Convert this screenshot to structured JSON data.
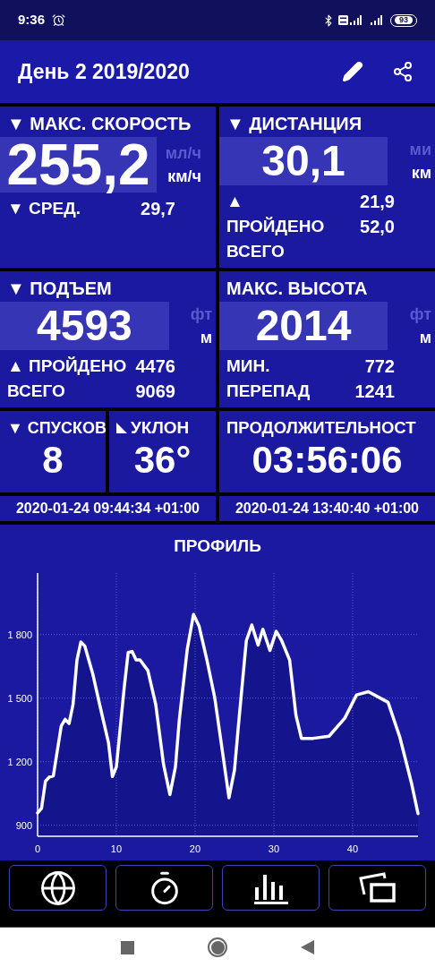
{
  "status_bar": {
    "time": "9:36",
    "battery": "93"
  },
  "app_bar": {
    "title": "День 2 2019/2020"
  },
  "max_speed": {
    "label": "▼ МАКС. СКОРОСТЬ",
    "value": "255,2",
    "units": [
      {
        "label": "мл/ч",
        "selected": false
      },
      {
        "label": "км/ч",
        "selected": true
      }
    ],
    "rows": [
      {
        "label": "▼ СРЕД.",
        "value": "29,7"
      }
    ]
  },
  "distance": {
    "label": "▼ ДИСТАНЦИЯ",
    "value": "30,1",
    "units": [
      {
        "label": "ми",
        "selected": false
      },
      {
        "label": "км",
        "selected": true
      }
    ],
    "rows": [
      {
        "label": "▲",
        "value": "21,9"
      },
      {
        "label": "ПРОЙДЕНО",
        "value": "52,0"
      },
      {
        "label": "ВСЕГО"
      }
    ]
  },
  "ascent": {
    "label": "▼ ПОДЪЕМ",
    "value": "4593",
    "units": [
      {
        "label": "фт",
        "selected": false
      },
      {
        "label": "м",
        "selected": true
      }
    ],
    "rows": [
      {
        "label": "▲ ПРОЙДЕНО",
        "value": "4476"
      },
      {
        "label": "ВСЕГО",
        "value": "9069"
      }
    ]
  },
  "max_altitude": {
    "label": "МАКС. ВЫСОТА",
    "value": "2014",
    "units": [
      {
        "label": "фт",
        "selected": false
      },
      {
        "label": "м",
        "selected": true
      }
    ],
    "rows": [
      {
        "label": "МИН.",
        "value": "772"
      },
      {
        "label": "ПЕРЕПАД",
        "value": "1241"
      }
    ]
  },
  "descents": {
    "label": "▼ СПУСКОВ",
    "value": "8"
  },
  "slope": {
    "label": "УКЛОН",
    "value": "36°"
  },
  "duration": {
    "label": "ПРОДОЛЖИТЕЛЬНОСТ",
    "value": "03:56:06"
  },
  "start_time": "2020-01-24 09:44:34 +01:00",
  "end_time": "2020-01-24 13:40:40 +01:00",
  "profile": {
    "title": "ПРОФИЛЬ",
    "chart_data": {
      "type": "area",
      "grid": true,
      "x": [
        0,
        0.5,
        1,
        1.5,
        2,
        3,
        3.5,
        4,
        4.5,
        5,
        5.5,
        6,
        7,
        8,
        9,
        9.5,
        10,
        11,
        11.5,
        12,
        12.5,
        13,
        14,
        15,
        16,
        16.8,
        17.5,
        18,
        19,
        19.8,
        20.5,
        21.5,
        22.5,
        23.5,
        24.3,
        25,
        25.5,
        26.5,
        27.2,
        28,
        28.6,
        29.5,
        30.3,
        31,
        32,
        32.8,
        33.5,
        35,
        37,
        39,
        40.5,
        42,
        43.5,
        44.5,
        46,
        47.5,
        48.3
      ],
      "series": [
        {
          "color": "#ffffff",
          "values": [
            958,
            980,
            1108,
            1128,
            1133,
            1368,
            1400,
            1380,
            1470,
            1680,
            1765,
            1745,
            1615,
            1450,
            1290,
            1130,
            1175,
            1550,
            1715,
            1720,
            1680,
            1680,
            1630,
            1470,
            1185,
            1045,
            1175,
            1400,
            1730,
            1895,
            1840,
            1680,
            1500,
            1240,
            1030,
            1160,
            1370,
            1770,
            1845,
            1750,
            1825,
            1725,
            1815,
            1770,
            1680,
            1420,
            1310,
            1310,
            1320,
            1405,
            1515,
            1530,
            1500,
            1480,
            1315,
            1095,
            955
          ]
        }
      ],
      "xlim": [
        0,
        48.3
      ],
      "ylim": [
        848,
        2090
      ],
      "xticks": [
        0,
        10,
        20,
        30,
        40
      ],
      "yticks": [
        {
          "value": 900,
          "label": "900"
        },
        {
          "value": 1200,
          "label": "1 200"
        },
        {
          "value": 1500,
          "label": "1 500"
        },
        {
          "value": 1800,
          "label": "1 800"
        }
      ]
    }
  },
  "bottom_tabs": [
    {
      "kind": "globe"
    },
    {
      "kind": "stopwatch"
    },
    {
      "kind": "bars"
    },
    {
      "kind": "windows"
    }
  ]
}
